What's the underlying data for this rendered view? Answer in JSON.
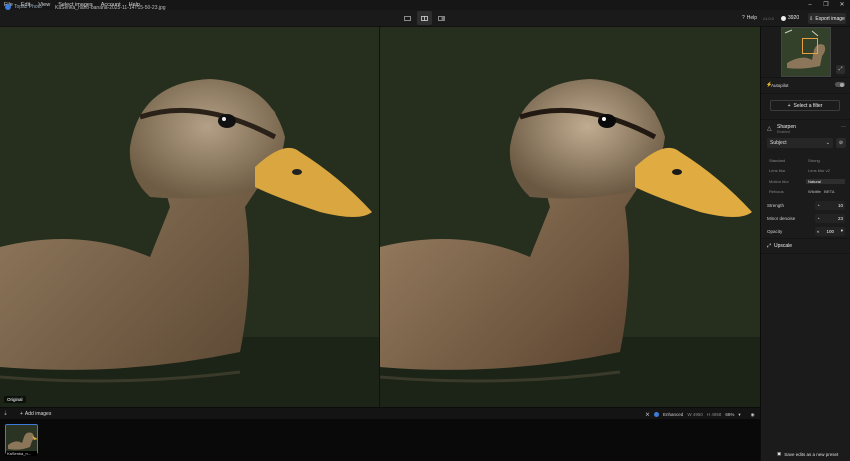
{
  "menu": [
    "File",
    "Edit",
    "View",
    "Select images",
    "Account",
    "Help"
  ],
  "window_controls": [
    "–",
    "❐",
    "✕"
  ],
  "topbar": {
    "app_name": "Topaz Photo",
    "file_name": "KaSenka_nano-banana-2025-11-14T15-50-23.jpg",
    "help_label": "Help",
    "version": "v1.0.0",
    "credits": "3920",
    "export_label": "Export image"
  },
  "viewer": {
    "left_label": "Original"
  },
  "bottombar": {
    "add_images": "Add images",
    "enhanced_label": "Enhanced",
    "width_label": "W 4950",
    "height_label": "H 4958",
    "zoom": "66%"
  },
  "filmstrip": {
    "thumb_label": "KaSenka_n..."
  },
  "sidebar": {
    "autopilot_label": "Autopilot",
    "select_filter": "Select a filter",
    "sharpen_title": "Sharpen",
    "sharpen_sub": "Enabled",
    "subject_value": "Subject",
    "models": [
      [
        "Standard",
        "Strong"
      ],
      [
        "Lens blur",
        "Lens blur v2"
      ],
      [
        "Motion blur",
        "Natural"
      ],
      [
        "Refocus",
        "Wildlife BETA"
      ]
    ],
    "selected_model": "Natural",
    "strength_label": "Strength",
    "strength_value": "10",
    "minor_denoise_label": "Minor denoise",
    "minor_denoise_value": "23",
    "opacity_label": "Opacity",
    "opacity_value": "100",
    "upscale_label": "Upscale",
    "save_preset": "Save edits as a new preset"
  },
  "colors": {
    "accent": "#3d7bd9",
    "autopilot": "#e8c040",
    "beta": "#8bd18b"
  }
}
